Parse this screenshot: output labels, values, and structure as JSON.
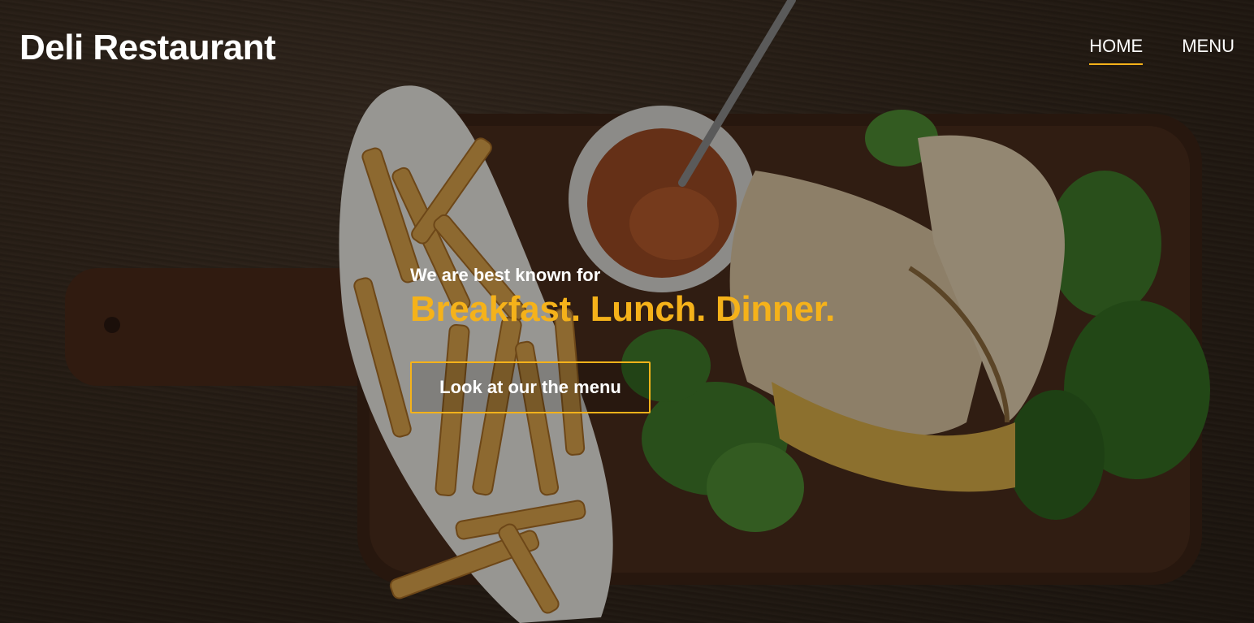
{
  "header": {
    "brand": "Deli Restaurant",
    "nav": [
      {
        "label": "HOME",
        "active": true
      },
      {
        "label": "MENU",
        "active": false
      }
    ]
  },
  "hero": {
    "tagline": "We are best known for",
    "headline": "Breakfast. Lunch. Dinner.",
    "cta_label": "Look at our the menu",
    "background_image": "food-photo-fries-sauce-sandwich-salad"
  },
  "colors": {
    "accent": "#f5b21a",
    "text": "#ffffff",
    "wood": "#3a2c20"
  }
}
